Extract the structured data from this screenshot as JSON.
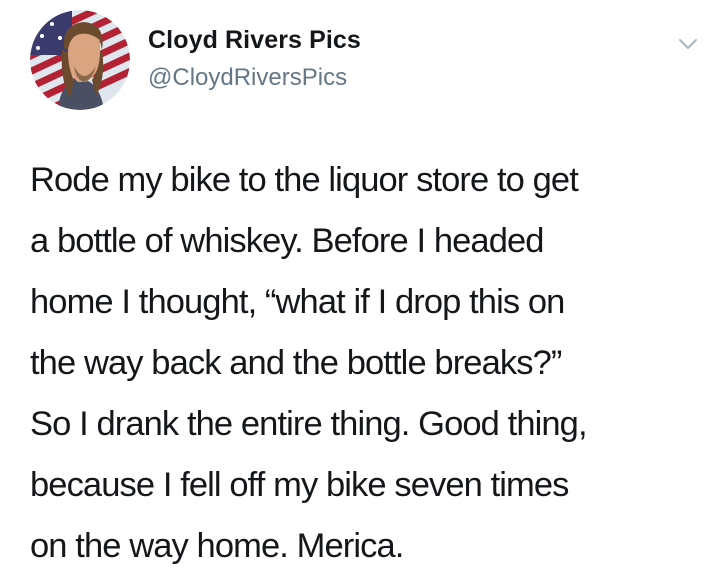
{
  "tweet": {
    "author": {
      "display_name": "Cloyd Rivers Pics",
      "handle": "@CloydRiversPics",
      "avatar_icon": "profile-photo-flag-background"
    },
    "menu_icon": "chevron-down-icon",
    "text": "Rode my bike to the liquor store to get\na bottle of whiskey. Before I headed\nhome I thought, “what if I drop this on\nthe way back and the bottle breaks?”\nSo I drank the entire thing. Good thing,\nbecause I fell off my bike seven times\non the way home. Merica."
  },
  "colors": {
    "text": "#14171a",
    "handle": "#657786",
    "chevron": "#aab8c2"
  }
}
